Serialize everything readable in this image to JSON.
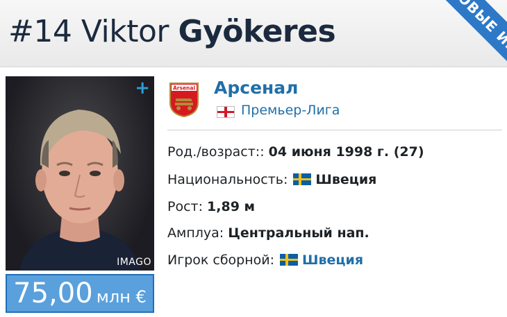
{
  "header": {
    "number": "#14",
    "first_name": "Viktor",
    "last_name": "Gyökeres",
    "ribbon": "НОВЫЕ ИГРОКИ"
  },
  "photo": {
    "plus_label": "+",
    "credit": "IMAGO"
  },
  "market_value": {
    "amount": "75,00",
    "unit": "млн €"
  },
  "club": {
    "name": "Арсенал",
    "logo_text": "Arsenal",
    "league": "Премьер-Лига",
    "league_flag": "england-flag-icon"
  },
  "info": {
    "birth_label": "Род./возраст::",
    "birth_value": "04 июня 1998 г. (27)",
    "nationality_label": "Национальность:",
    "nationality_value": "Швеция",
    "height_label": "Рост:",
    "height_value": "1,89 м",
    "position_label": "Амплуа:",
    "position_value": "Центральный нап.",
    "national_team_label": "Игрок сборной:",
    "national_team_value": "Швеция"
  },
  "colors": {
    "accent": "#1f6fa8",
    "value_box": "#5aa0dc",
    "ribbon": "#2e78c8"
  }
}
